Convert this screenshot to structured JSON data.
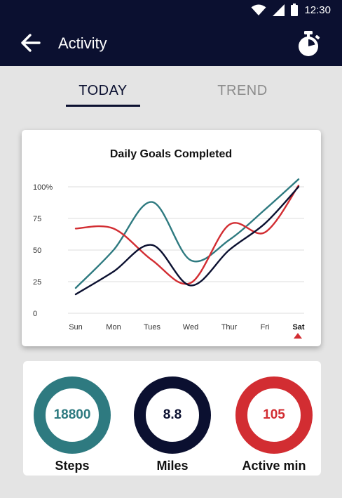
{
  "status_bar": {
    "time": "12:30",
    "icons": [
      "wifi-icon",
      "cell-signal-icon",
      "battery-icon"
    ]
  },
  "app_bar": {
    "title": "Activity",
    "back_icon": "arrow-left-icon",
    "action_icon": "stopwatch-icon"
  },
  "tabs": [
    {
      "label": "TODAY",
      "selected": true
    },
    {
      "label": "TREND",
      "selected": false
    }
  ],
  "colors": {
    "navy": "#0b1030",
    "teal": "#2e7a80",
    "red": "#d22d32",
    "background": "#e4e4e4"
  },
  "chart_data": {
    "type": "line",
    "title": "Daily Goals Completed",
    "categories": [
      "Sun",
      "Mon",
      "Tues",
      "Wed",
      "Thur",
      "Fri",
      "Sat"
    ],
    "y_ticks": [
      "100%",
      "75",
      "50",
      "25",
      "0"
    ],
    "ylim": [
      0,
      100
    ],
    "grid": true,
    "selected_category": "Sat",
    "series": [
      {
        "color": "#2e7a80",
        "values": [
          20,
          50,
          88,
          42,
          58,
          82,
          106
        ]
      },
      {
        "color": "#d22d32",
        "values": [
          67,
          67,
          42,
          24,
          70,
          64,
          101
        ]
      },
      {
        "color": "#0b1030",
        "values": [
          15,
          33,
          54,
          22,
          50,
          71,
          100
        ]
      }
    ]
  },
  "stats": [
    {
      "value": "18800",
      "label": "Steps",
      "color": "#2e7a80"
    },
    {
      "value": "8.8",
      "label": "Miles",
      "color": "#0b1030"
    },
    {
      "value": "105",
      "label": "Active min",
      "color": "#d22d32"
    }
  ]
}
